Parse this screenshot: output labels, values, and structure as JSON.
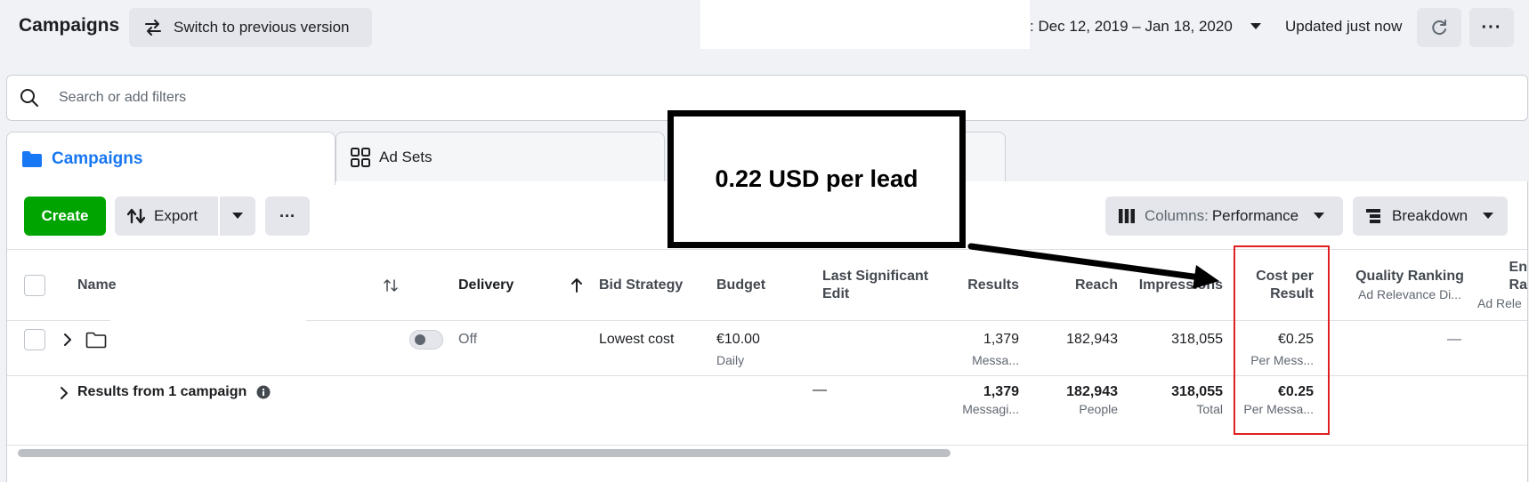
{
  "header": {
    "title": "Campaigns",
    "switch_label": "Switch to previous version",
    "date_range": ": Dec 12, 2019 – Jan 18, 2020",
    "updated": "Updated just now",
    "more_label": "···"
  },
  "search": {
    "placeholder": "Search or add filters",
    "value": ""
  },
  "tabs": [
    {
      "label": "Campaigns",
      "icon": "folder-icon",
      "active": true
    },
    {
      "label": "Ad Sets",
      "icon": "grid-icon",
      "active": false
    },
    {
      "label": "",
      "icon": "",
      "active": false
    }
  ],
  "toolbar": {
    "create_label": "Create",
    "export_label": "Export",
    "more_label": "···",
    "columns_prefix": "Columns:",
    "columns_value": "Performance",
    "breakdown_label": "Breakdown"
  },
  "table": {
    "headers": {
      "name": "Name",
      "delivery": "Delivery",
      "bid_strategy": "Bid Strategy",
      "budget": "Budget",
      "last_edit_1": "Last Significant",
      "last_edit_2": "Edit",
      "results": "Results",
      "reach": "Reach",
      "impressions": "Impressions",
      "cost_1": "Cost per",
      "cost_2": "Result",
      "quality": "Quality Ranking",
      "quality_sub": "Ad Relevance Di...",
      "engagement_1": "En",
      "engagement_2": "Ra",
      "engagement_sub": "Ad Rele"
    },
    "row": {
      "delivery": "Off",
      "bid_strategy": "Lowest cost",
      "budget": "€10.00",
      "budget_sub": "Daily",
      "results": "1,379",
      "results_sub": "Messa...",
      "reach": "182,943",
      "impressions": "318,055",
      "cost": "€0.25",
      "cost_sub": "Per Mess...",
      "quality": "—"
    },
    "summary": {
      "label": "Results from 1 campaign",
      "last_edit": "—",
      "results": "1,379",
      "results_sub": "Messagi...",
      "reach": "182,943",
      "reach_sub": "People",
      "impressions": "318,055",
      "impressions_sub": "Total",
      "cost": "€0.25",
      "cost_sub": "Per Messa..."
    }
  },
  "annotation": {
    "callout_text": "0.22 USD per lead",
    "highlight_color": "#e02020"
  },
  "colors": {
    "accent": "#1877f2",
    "create_green": "#00a400",
    "button_gray": "#e4e6eb"
  }
}
